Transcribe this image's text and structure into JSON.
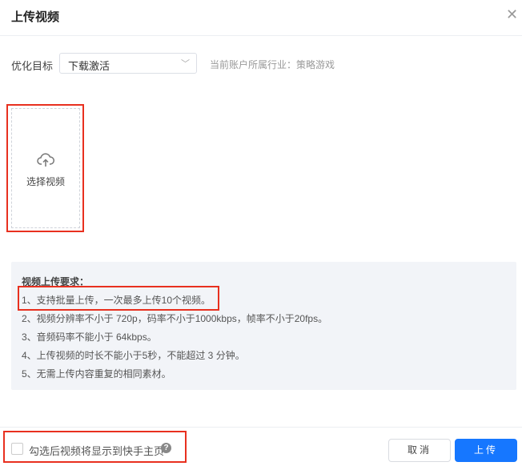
{
  "dialog": {
    "title": "上传视频",
    "close_icon": "close-icon"
  },
  "form": {
    "optimize_label": "优化目标",
    "optimize_value": "下载激活",
    "industry_hint": "当前账户所属行业：策略游戏"
  },
  "upload": {
    "icon": "cloud-upload-icon",
    "label": "选择视频"
  },
  "requirements": {
    "heading": "视频上传要求：",
    "lines": [
      "1、支持批量上传，一次最多上传10个视频。",
      "2、视频分辨率不小于 720p，码率不小于1000kbps，帧率不小于20fps。",
      "3、音频码率不能小于 64kbps。",
      "4、上传视频的时长不能小于5秒，不能超过 3 分钟。",
      "5、无需上传内容重复的相同素材。"
    ]
  },
  "footer": {
    "checkbox_label": "勾选后视频将显示到快手主页",
    "checked": false,
    "help": "?",
    "cancel": "取消",
    "submit": "上传"
  },
  "colors": {
    "primary": "#1677ff",
    "highlight": "#e8301f",
    "panel": "#f2f4f8"
  }
}
